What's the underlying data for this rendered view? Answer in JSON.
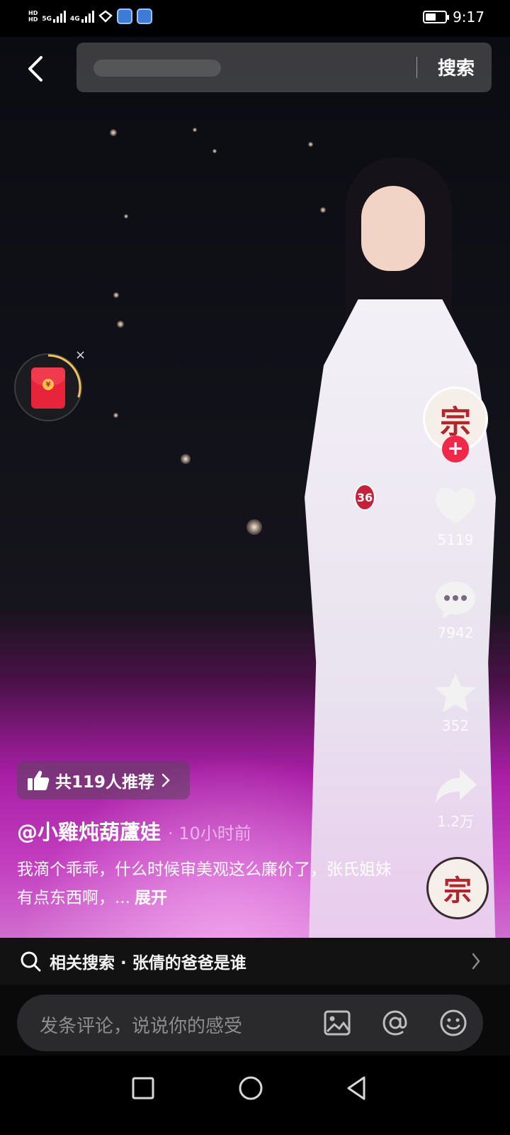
{
  "status_bar": {
    "network_5g": "5G",
    "network_4g": "4G",
    "hd_label": "HD",
    "time": "9:17",
    "battery_level": 0.55
  },
  "search": {
    "button_label": "搜索"
  },
  "red_packet": {
    "coin_symbol": "¥",
    "close_symbol": "×",
    "progress": 0.3
  },
  "rail": {
    "avatar_mark": "宗",
    "follow_symbol": "+",
    "likes": "5119",
    "comments": "7942",
    "favorites": "352",
    "shares": "1.2万"
  },
  "video": {
    "contestant_number": "36"
  },
  "post": {
    "recommend_label": "共119人推荐",
    "author": "@小雞炖葫蘆娃",
    "time": "· 10小时前",
    "caption": "我滴个乖乖，什么时候审美观这么廉价了，张氏姐妹有点东西啊，...",
    "expand_label": "展开"
  },
  "related_search": {
    "label": "相关搜索 · 张倩的爸爸是谁"
  },
  "comment_bar": {
    "placeholder": "发条评论，说说你的感受"
  },
  "colors": {
    "follow_red": "#f0294a",
    "red_packet": "#e8243a",
    "stage_magenta": "#c33fc0"
  }
}
